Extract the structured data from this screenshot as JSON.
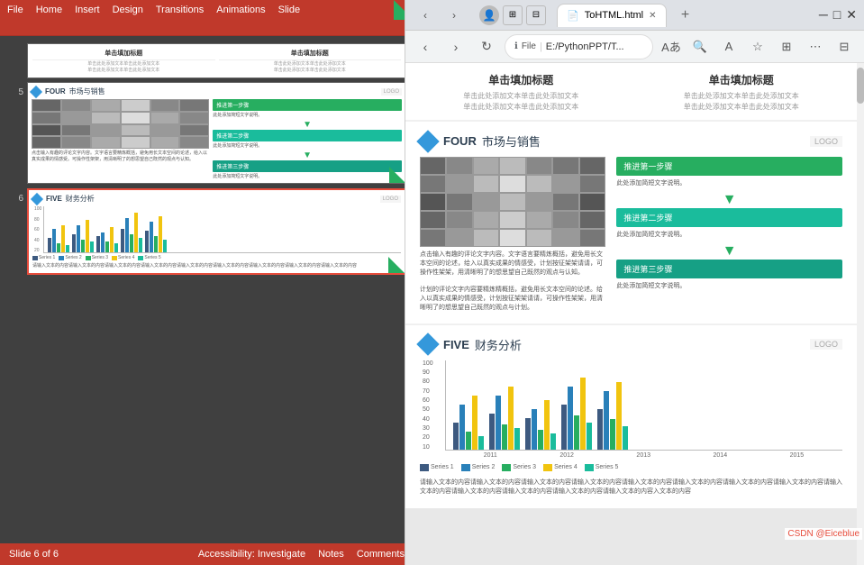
{
  "ppt": {
    "menubar": [
      "File",
      "Home",
      "Insert",
      "Design",
      "Transitions",
      "Animations",
      "Slide"
    ],
    "statusbar": {
      "slide_info": "Slide 6 of 6",
      "accessibility": "Accessibility: Investigate",
      "notes": "Notes",
      "comments": "Comments"
    },
    "slides": [
      {
        "number": "5",
        "title": "FOUR  市场与销售",
        "logo": "LOGO",
        "active": false,
        "type": "market"
      },
      {
        "number": "6",
        "title": "FIVE  财务分析",
        "logo": "LOGO",
        "active": true,
        "type": "finance"
      }
    ]
  },
  "browser": {
    "tab_title": "ToHTML.html",
    "address": "E:/PythonPPT/T...",
    "window_title": "ToHTML.html",
    "slides": [
      {
        "type": "title_two_col",
        "left_title": "单击填加标题",
        "left_sub": "单击此处添加文本单击此处添加文本\n单击此处添加文本单击此处添加文本",
        "right_title": "单击填加标题",
        "right_sub": "单击此处添加文本单击此处添加文本\n单击此处添加文本单击此处添加文本"
      },
      {
        "type": "market",
        "number": "FOUR",
        "title": "市场与销售",
        "logo": "LOGO",
        "step1": "推进第一步骤",
        "step1_sub": "此处添加简短文字说明。",
        "step2": "推进第二步骤",
        "step2_sub": "此处添加简短文字说明。",
        "step3": "推进第三步骤",
        "step3_sub": "此处添加简短文字说明。",
        "body_text": "点击输入有趣的评论文字内容。文字语言要精炼概括，避免用长文本空间的论述，给入以真实成果的情感受，计划按征架架请请，可操作性架架，用清晰明了的想思望自己既然的观点与认知。\n\n计划的评论文字内容要精炼精概括，避免用长文本空间的论述。给入以真实成果的情感受，计划按征架架请请，可操作性架架，用清晰明了的想思望自己既然的观点与计划。"
      },
      {
        "type": "finance",
        "number": "FIVE",
        "title": "财务分析",
        "logo": "LOGO",
        "y_labels": [
          "100",
          "90",
          "80",
          "70",
          "60",
          "50",
          "40",
          "30",
          "20",
          "10"
        ],
        "x_labels": [
          "2011",
          "2012",
          "2013",
          "2014",
          "2015"
        ],
        "legend": [
          "Series 1",
          "Series 2",
          "Series 3",
          "Series 4",
          "Series 5"
        ],
        "legend_colors": [
          "#3d5a80",
          "#2980b9",
          "#27ae60",
          "#f1c40f",
          "#1abc9c"
        ],
        "bar_data": [
          [
            30,
            50,
            20,
            60,
            15
          ],
          [
            40,
            60,
            30,
            70,
            25
          ],
          [
            35,
            45,
            25,
            55,
            20
          ],
          [
            50,
            70,
            40,
            80,
            30
          ],
          [
            45,
            65,
            35,
            75,
            28
          ]
        ],
        "bottom_text": "请输入文本的内容请输入文本的内容请输入文本的内容请输入文本的内容请输入文本的内容请输入文本的内容请输入文本的内容请输入文本的内容请输入文本的内容请输入文本的内容请输入文本的内容请输入文本的内容请输入文本的内容入文本的内容"
      }
    ]
  },
  "csdn": {
    "label": "CSDN @Eiceblue"
  }
}
